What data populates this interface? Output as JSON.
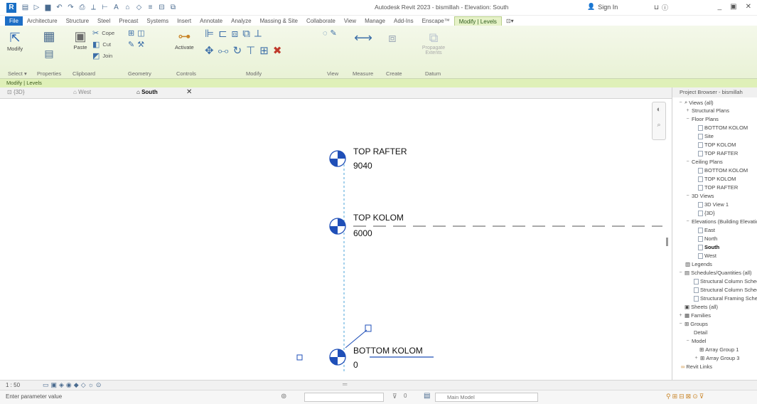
{
  "app": {
    "title": "Autodesk Revit 2023 - bismillah - Elevation: South",
    "sign_in": "Sign In",
    "logo": "R"
  },
  "ribbon_tabs": [
    "File",
    "Architecture",
    "Structure",
    "Steel",
    "Precast",
    "Systems",
    "Insert",
    "Annotate",
    "Analyze",
    "Massing & Site",
    "Collaborate",
    "View",
    "Manage",
    "Add-Ins",
    "Enscape™",
    "Modify | Levels"
  ],
  "ribbon": {
    "modify_label": "Modify",
    "paste_label": "Paste",
    "cope_label": "Cope",
    "cut_label": "Cut",
    "join_label": "Join",
    "activate_label": "Activate",
    "propagate_label": "Propagate Extents",
    "groups": {
      "select": "Select",
      "properties": "Properties",
      "clipboard": "Clipboard",
      "geometry": "Geometry",
      "controls": "Controls",
      "modify": "Modify",
      "view": "View",
      "measure": "Measure",
      "create": "Create",
      "datum": "Datum"
    }
  },
  "context_band": "Modify | Levels",
  "view_tabs": {
    "tab1": "{3D}",
    "tab2": "West",
    "tab3": "South"
  },
  "levels": [
    {
      "name": "TOP RAFTER",
      "elevation": "9040"
    },
    {
      "name": "TOP KOLOM",
      "elevation": "6000"
    },
    {
      "name": "BOTTOM KOLOM",
      "elevation": "0"
    }
  ],
  "browser": {
    "header": "Project Browser - bismillah",
    "items": [
      {
        "label": "Views (all)",
        "level": 0
      },
      {
        "label": "Structural Plans",
        "level": 1
      },
      {
        "label": "Floor Plans",
        "level": 1
      },
      {
        "label": "BOTTOM KOLOM",
        "level": 2
      },
      {
        "label": "Site",
        "level": 2
      },
      {
        "label": "TOP KOLOM",
        "level": 2
      },
      {
        "label": "TOP RAFTER",
        "level": 2
      },
      {
        "label": "Ceiling Plans",
        "level": 1
      },
      {
        "label": "BOTTOM KOLOM",
        "level": 2
      },
      {
        "label": "TOP KOLOM",
        "level": 2
      },
      {
        "label": "TOP RAFTER",
        "level": 2
      },
      {
        "label": "3D Views",
        "level": 1
      },
      {
        "label": "3D View 1",
        "level": 2
      },
      {
        "label": "{3D}",
        "level": 2
      },
      {
        "label": "Elevations (Building Elevation)",
        "level": 1
      },
      {
        "label": "East",
        "level": 2
      },
      {
        "label": "North",
        "level": 2
      },
      {
        "label": "South",
        "level": 2,
        "selected": true
      },
      {
        "label": "West",
        "level": 2
      },
      {
        "label": "Legends",
        "level": 0
      },
      {
        "label": "Schedules/Quantities (all)",
        "level": 0
      },
      {
        "label": "Structural Column Schedule",
        "level": 1
      },
      {
        "label": "Structural Column Schedule",
        "level": 1
      },
      {
        "label": "Structural Framing Schedule",
        "level": 1
      },
      {
        "label": "Sheets (all)",
        "level": 0
      },
      {
        "label": "Families",
        "level": 0
      },
      {
        "label": "Groups",
        "level": 0
      },
      {
        "label": "Detail",
        "level": 1
      },
      {
        "label": "Model",
        "level": 1
      },
      {
        "label": "Array Group 1",
        "level": 2
      },
      {
        "label": "Array Group 3",
        "level": 2
      },
      {
        "label": "Revit Links",
        "level": 0
      }
    ]
  },
  "status": {
    "view_scale": "1 : 50",
    "bottom_text": "Enter parameter value",
    "workset": "Main Model",
    "filter_count": "0"
  },
  "colors": {
    "ribbon_bg": "#e9f2d6",
    "file_tab": "#1d6ec6",
    "context_band": "#dff0b8",
    "level_head_blue": "#1f4fb8",
    "level_line_dashed": "#4aa3d8"
  }
}
